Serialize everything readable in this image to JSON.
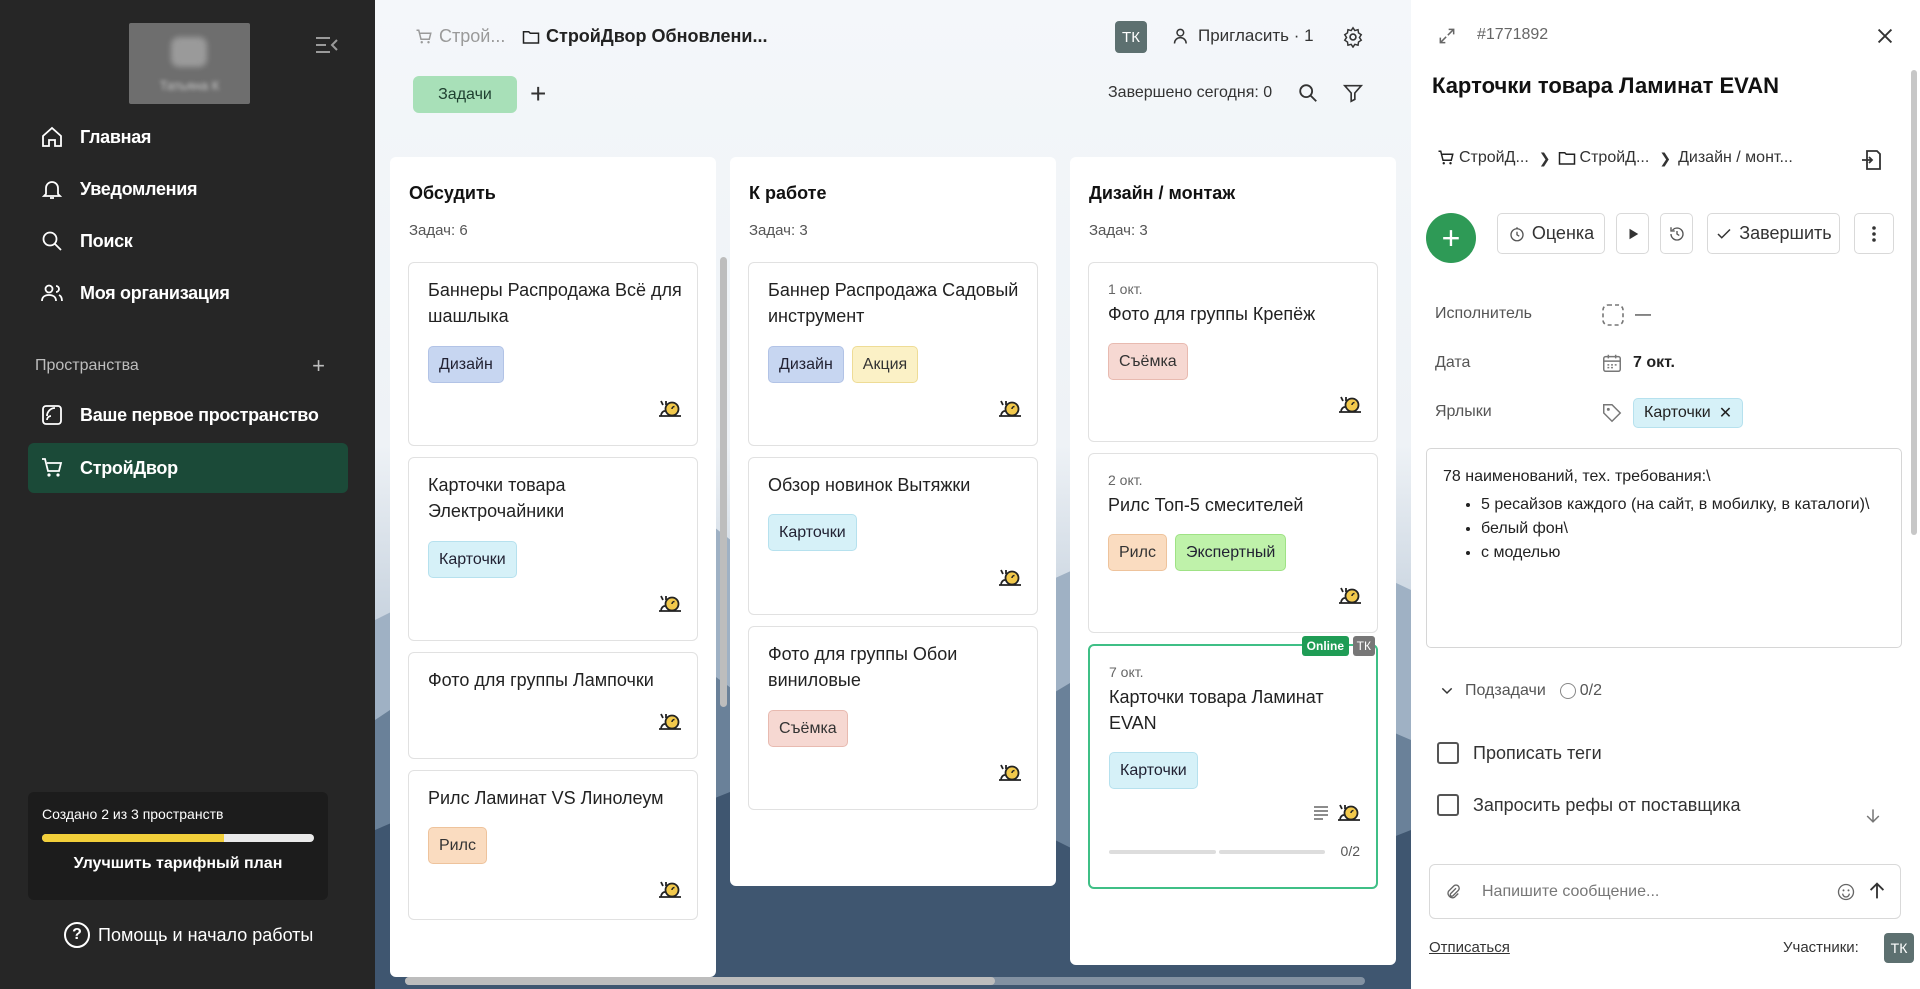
{
  "sidebar": {
    "user_name": "Татьяна К",
    "nav": [
      {
        "label": "Главная",
        "icon": "home-icon"
      },
      {
        "label": "Уведомления",
        "icon": "bell-icon"
      },
      {
        "label": "Поиск",
        "icon": "search-icon"
      },
      {
        "label": "Моя организация",
        "icon": "people-icon"
      }
    ],
    "spaces_title": "Пространства",
    "spaces": [
      {
        "label": "Ваше первое пространство",
        "icon": "space-icon",
        "active": false
      },
      {
        "label": "СтройДвор",
        "icon": "cart-icon",
        "active": true
      }
    ],
    "plan": {
      "text": "Создано 2 из 3 пространств",
      "progress": 0.67,
      "button": "Улучшить тарифный план"
    },
    "help": "Помощь и начало работы"
  },
  "board": {
    "crumb_space": "Строй...",
    "crumb_project": "СтройДвор Обновлени...",
    "user_initials": "ТК",
    "invite": "Пригласить · 1",
    "tab_tasks": "Задачи",
    "done_today": "Завершено сегодня: 0",
    "columns": [
      {
        "title": "Обсудить",
        "count": "Задач: 6",
        "cards": [
          {
            "title": "Баннеры Распродажа Всё для шашлыка",
            "tags": [
              {
                "label": "Дизайн",
                "kind": "design"
              }
            ]
          },
          {
            "title": "Карточки товара Электрочайники",
            "tags": [
              {
                "label": "Карточки",
                "kind": "cards"
              }
            ]
          },
          {
            "title": "Фото для группы Лампочки",
            "tags": []
          },
          {
            "title": "Рилс Ламинат VS Линолеум",
            "tags": [
              {
                "label": "Рилс",
                "kind": "reels"
              }
            ]
          }
        ]
      },
      {
        "title": "К работе",
        "count": "Задач: 3",
        "cards": [
          {
            "title": "Баннер Распродажа Садовый инструмент",
            "tags": [
              {
                "label": "Дизайн",
                "kind": "design"
              },
              {
                "label": "Акция",
                "kind": "action"
              }
            ]
          },
          {
            "title": "Обзор новинок Вытяжки",
            "tags": [
              {
                "label": "Карточки",
                "kind": "cards"
              }
            ]
          },
          {
            "title": "Фото для группы Обои виниловые",
            "tags": [
              {
                "label": "Съёмка",
                "kind": "shoot"
              }
            ]
          }
        ]
      },
      {
        "title": "Дизайн / монтаж",
        "count": "Задач: 3",
        "cards": [
          {
            "date": "1 окт.",
            "title": "Фото для группы Крепёж",
            "tags": [
              {
                "label": "Съёмка",
                "kind": "shoot"
              }
            ]
          },
          {
            "date": "2 окт.",
            "title": "Рилс Топ-5 смесителей",
            "tags": [
              {
                "label": "Рилс",
                "kind": "reels"
              },
              {
                "label": "Экспертный",
                "kind": "expert"
              }
            ]
          },
          {
            "date": "7 окт.",
            "title": "Карточки товара Ламинат EVAN",
            "tags": [
              {
                "label": "Карточки",
                "kind": "cards"
              }
            ],
            "online": "Online",
            "assignee": "ТК",
            "progress": "0/2",
            "selected": true
          }
        ]
      }
    ]
  },
  "detail": {
    "id": "#1771892",
    "title": "Карточки товара Ламинат EVAN",
    "crumbs": [
      "СтройД...",
      "СтройД...",
      "Дизайн / монт..."
    ],
    "buttons": {
      "estimate": "Оценка",
      "complete": "Завершить"
    },
    "assignee_label": "Исполнитель",
    "assignee_value": "—",
    "date_label": "Дата",
    "date_value": "7 окт.",
    "labels_label": "Ярлыки",
    "label_tag": "Карточки",
    "description": {
      "intro": "78 наименований, тех. требования:\\",
      "items": [
        "5 ресайзов каждого (на сайт, в мобилку, в каталоги)\\",
        "белый фон\\",
        "с моделью"
      ]
    },
    "subtasks_label": "Подзадачи",
    "subtasks_count": "0/2",
    "subtasks": [
      "Прописать теги",
      "Запросить рефы от поставщика"
    ],
    "message_placeholder": "Напишите сообщение...",
    "unsubscribe": "Отписаться",
    "members_label": "Участники:",
    "member_initials": "ТК"
  },
  "colors": {
    "accent": "#2e9a56",
    "active_space": "#1b4a38",
    "sidebar_bg": "#262626",
    "tab_bg": "#a8e0b8"
  }
}
